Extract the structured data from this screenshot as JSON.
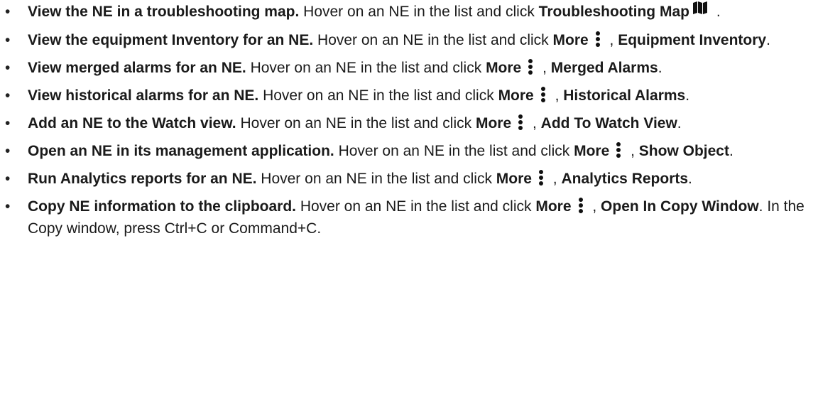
{
  "bullet_char": "•",
  "icons": {
    "more": "vertical-ellipsis-icon",
    "map": "map-icon"
  },
  "items": [
    {
      "lead": "View the NE in a troubleshooting map.",
      "text": " Hover on an NE in the list and click ",
      "action": "Troubleshooting Map",
      "tail": " ."
    },
    {
      "lead": "View the equipment Inventory for an NE.",
      "text": " Hover on an NE in the list and click ",
      "more": "More",
      "sep": " , ",
      "target": "Equipment Inventory",
      "tail": "."
    },
    {
      "lead": "View merged alarms for an NE.",
      "text": " Hover on an NE in the list and click ",
      "more": "More",
      "sep": " , ",
      "target": "Merged Alarms",
      "tail": "."
    },
    {
      "lead": "View historical alarms for an NE.",
      "text": " Hover on an NE in the list and click ",
      "more": "More",
      "sep": " , ",
      "target": "Historical Alarms",
      "tail": "."
    },
    {
      "lead": "Add an NE to the Watch view.",
      "text": " Hover on an NE in the list and click ",
      "more": "More",
      "sep": " , ",
      "target": "Add To Watch View",
      "tail": "."
    },
    {
      "lead": "Open an NE in its management application.",
      "text": " Hover on an NE in the list and click ",
      "more": "More",
      "sep": " , ",
      "target": "Show Object",
      "tail": "."
    },
    {
      "lead": "Run Analytics reports for an NE.",
      "text": " Hover on an NE in the list and click ",
      "more": "More",
      "sep": " , ",
      "target": "Analytics Reports",
      "tail": "."
    },
    {
      "lead": "Copy NE information to the clipboard.",
      "text": " Hover on an NE in the list and click ",
      "more": "More",
      "sep": " , ",
      "target": "Open In Copy Window",
      "tail": ". In the Copy window, press Ctrl+C or Command+C."
    }
  ]
}
